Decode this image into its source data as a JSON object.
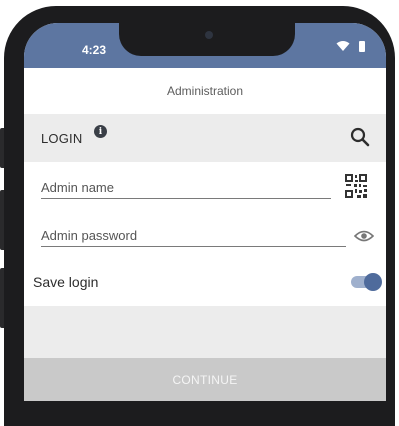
{
  "status_bar": {
    "time": "4:23",
    "wifi_icon": "wifi-icon",
    "battery_icon": "battery-icon",
    "color": "#5d76a1"
  },
  "header": {
    "title": "Administration"
  },
  "login_section": {
    "label": "LOGIN",
    "info_icon": "info-icon",
    "info_glyph": "i",
    "search_icon": "search-icon"
  },
  "fields": {
    "admin_name": {
      "placeholder": "Admin name",
      "value": "",
      "icon": "qr-code-icon"
    },
    "admin_password": {
      "placeholder": "Admin password",
      "value": "",
      "icon": "eye-icon"
    }
  },
  "save_login": {
    "label": "Save login",
    "enabled": true,
    "accent": "#4f6b9c"
  },
  "continue_button": {
    "label": "CONTINUE"
  }
}
